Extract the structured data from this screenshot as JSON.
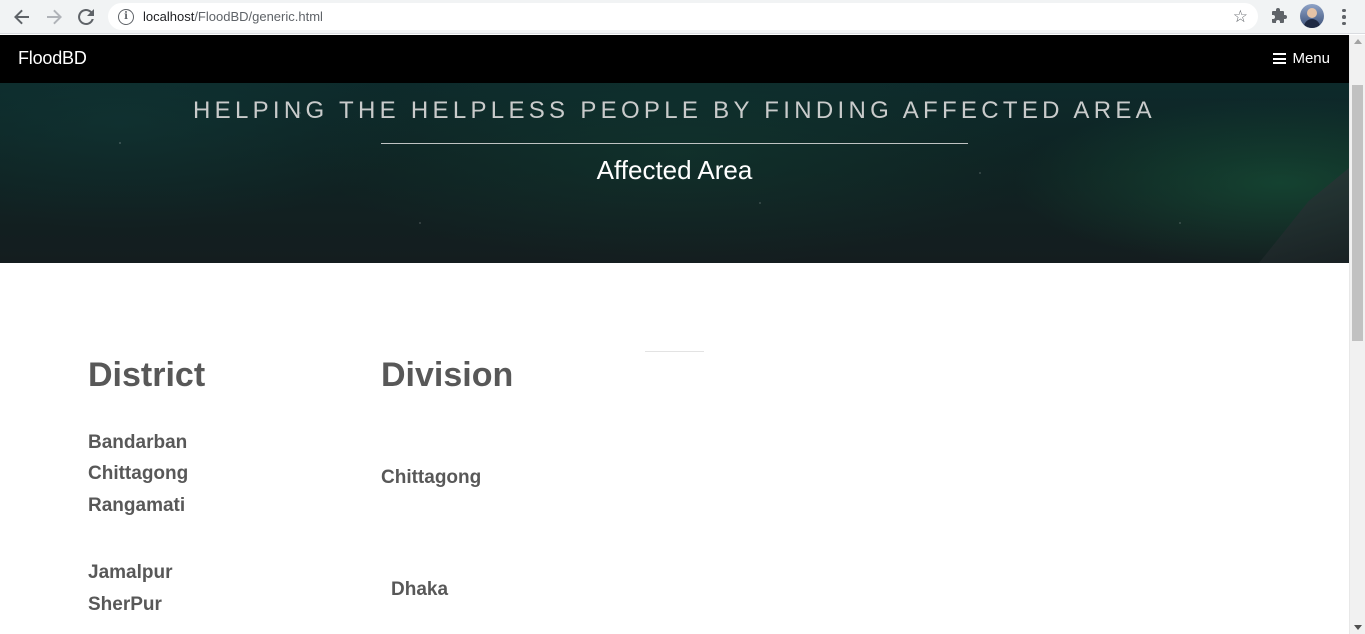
{
  "browser": {
    "url_host": "localhost",
    "url_path": "/FloodBD/generic.html"
  },
  "navbar": {
    "brand": "FloodBD",
    "menu_label": "Menu"
  },
  "hero": {
    "title": "HELPING THE HELPLESS PEOPLE BY FINDING AFFECTED AREA",
    "subtitle": "Affected Area"
  },
  "table": {
    "district_header": "District",
    "division_header": "Division",
    "districts": [
      "Bandarban",
      "Chittagong",
      "Rangamati",
      "Jamalpur",
      "SherPur"
    ],
    "divisions": [
      "Chittagong",
      "Dhaka"
    ]
  }
}
